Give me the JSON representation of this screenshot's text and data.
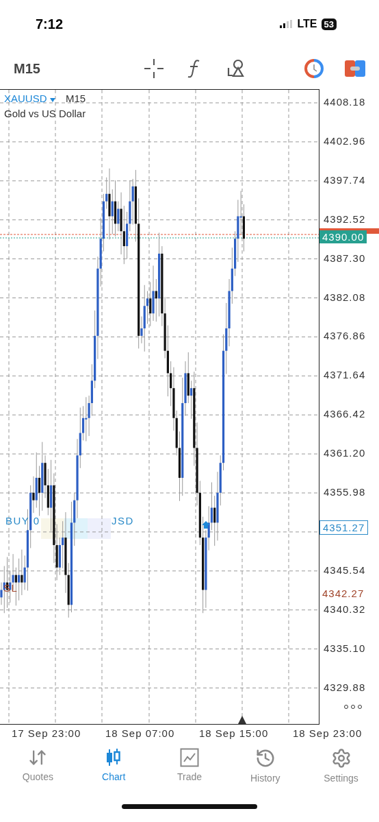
{
  "status_bar": {
    "time": "7:12",
    "network": "LTE",
    "battery": "53"
  },
  "toolbar": {
    "timeframe": "M15"
  },
  "chart": {
    "symbol": "XAUUSD",
    "timeframe": "M15",
    "description": "Gold vs US Dollar",
    "price_ticks": [
      "4408.18",
      "4402.96",
      "4397.74",
      "4392.52",
      "4387.30",
      "4382.08",
      "4376.86",
      "4371.64",
      "4366.42",
      "4361.20",
      "4355.98",
      "4345.54",
      "4340.32",
      "4335.10",
      "4329.88"
    ],
    "price_labels": [
      {
        "kind": "bid",
        "text": "4390.00"
      },
      {
        "kind": "buy",
        "text": "4351.27"
      },
      {
        "kind": "sl",
        "text": "4342.27"
      }
    ],
    "order_labels": [
      {
        "kind": "buy",
        "text": "BUY 0"
      },
      {
        "kind": "buy-tail",
        "text": "JSD"
      },
      {
        "kind": "sl",
        "text": "SL"
      }
    ],
    "time_labels": [
      "17 Sep 23:00",
      "18 Sep 07:00",
      "18 Sep 15:00",
      "18 Sep 23:00"
    ]
  },
  "tabs": [
    {
      "label": "Quotes",
      "selected": false
    },
    {
      "label": "Chart",
      "selected": true
    },
    {
      "label": "Trade",
      "selected": false
    },
    {
      "label": "History",
      "selected": false
    },
    {
      "label": "Settings",
      "selected": false
    }
  ]
}
